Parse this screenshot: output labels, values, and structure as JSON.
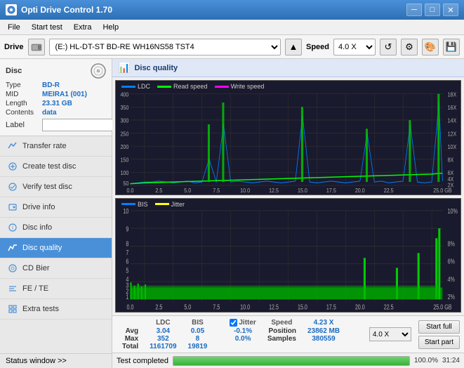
{
  "window": {
    "title": "Opti Drive Control 1.70",
    "minimize": "─",
    "maximize": "□",
    "close": "✕"
  },
  "menu": {
    "items": [
      "File",
      "Start test",
      "Extra",
      "Help"
    ]
  },
  "toolbar": {
    "drive_label": "Drive",
    "drive_value": "(E:)  HL-DT-ST BD-RE  WH16NS58 TST4",
    "speed_label": "Speed",
    "speed_value": "4.0 X"
  },
  "disc": {
    "title": "Disc",
    "type_label": "Type",
    "type_value": "BD-R",
    "mid_label": "MID",
    "mid_value": "MEIRA1 (001)",
    "length_label": "Length",
    "length_value": "23.31 GB",
    "contents_label": "Contents",
    "contents_value": "data",
    "label_label": "Label",
    "label_value": ""
  },
  "nav": {
    "items": [
      {
        "id": "transfer-rate",
        "label": "Transfer rate",
        "active": false
      },
      {
        "id": "create-test-disc",
        "label": "Create test disc",
        "active": false
      },
      {
        "id": "verify-test-disc",
        "label": "Verify test disc",
        "active": false
      },
      {
        "id": "drive-info",
        "label": "Drive info",
        "active": false
      },
      {
        "id": "disc-info",
        "label": "Disc info",
        "active": false
      },
      {
        "id": "disc-quality",
        "label": "Disc quality",
        "active": true
      },
      {
        "id": "cd-bier",
        "label": "CD Bier",
        "active": false
      },
      {
        "id": "fe-te",
        "label": "FE / TE",
        "active": false
      },
      {
        "id": "extra-tests",
        "label": "Extra tests",
        "active": false
      }
    ]
  },
  "status_window": {
    "label": "Status window >>"
  },
  "disc_quality": {
    "title": "Disc quality",
    "legend": {
      "ldc_label": "LDC",
      "ldc_color": "#0080ff",
      "read_speed_label": "Read speed",
      "read_speed_color": "#00ff00",
      "write_speed_label": "Write speed",
      "write_speed_color": "#ff00ff"
    },
    "bis_legend": {
      "bis_label": "BIS",
      "bis_color": "#0080ff",
      "jitter_label": "Jitter",
      "jitter_color": "#ffff00"
    },
    "chart1_y_right": [
      "18X",
      "16X",
      "14X",
      "12X",
      "10X",
      "8X",
      "6X",
      "4X",
      "2X"
    ],
    "chart1_y_left": [
      "400",
      "350",
      "300",
      "250",
      "200",
      "150",
      "100",
      "50"
    ],
    "chart2_y_right": [
      "10%",
      "8%",
      "6%",
      "4%",
      "2%"
    ],
    "chart2_y_left": [
      "10",
      "9",
      "8",
      "7",
      "6",
      "5",
      "4",
      "3",
      "2",
      "1"
    ],
    "x_labels": [
      "0.0",
      "2.5",
      "5.0",
      "7.5",
      "10.0",
      "12.5",
      "15.0",
      "17.5",
      "20.0",
      "22.5",
      "25.0 GB"
    ]
  },
  "stats": {
    "headers": [
      "LDC",
      "BIS",
      "",
      "Jitter",
      "Speed",
      "4.23 X"
    ],
    "speed_dropdown": "4.0 X",
    "avg_label": "Avg",
    "avg_ldc": "3.04",
    "avg_bis": "0.05",
    "avg_jitter": "-0.1%",
    "max_label": "Max",
    "max_ldc": "352",
    "max_bis": "8",
    "max_jitter": "0.0%",
    "total_label": "Total",
    "total_ldc": "1161709",
    "total_bis": "19819",
    "position_label": "Position",
    "position_value": "23862 MB",
    "samples_label": "Samples",
    "samples_value": "380559",
    "jitter_checked": true,
    "jitter_label": "Jitter",
    "start_full_label": "Start full",
    "start_part_label": "Start part"
  },
  "bottom_bar": {
    "status": "Test completed",
    "progress": 100,
    "progress_text": "100.0%",
    "time": "31:24"
  }
}
